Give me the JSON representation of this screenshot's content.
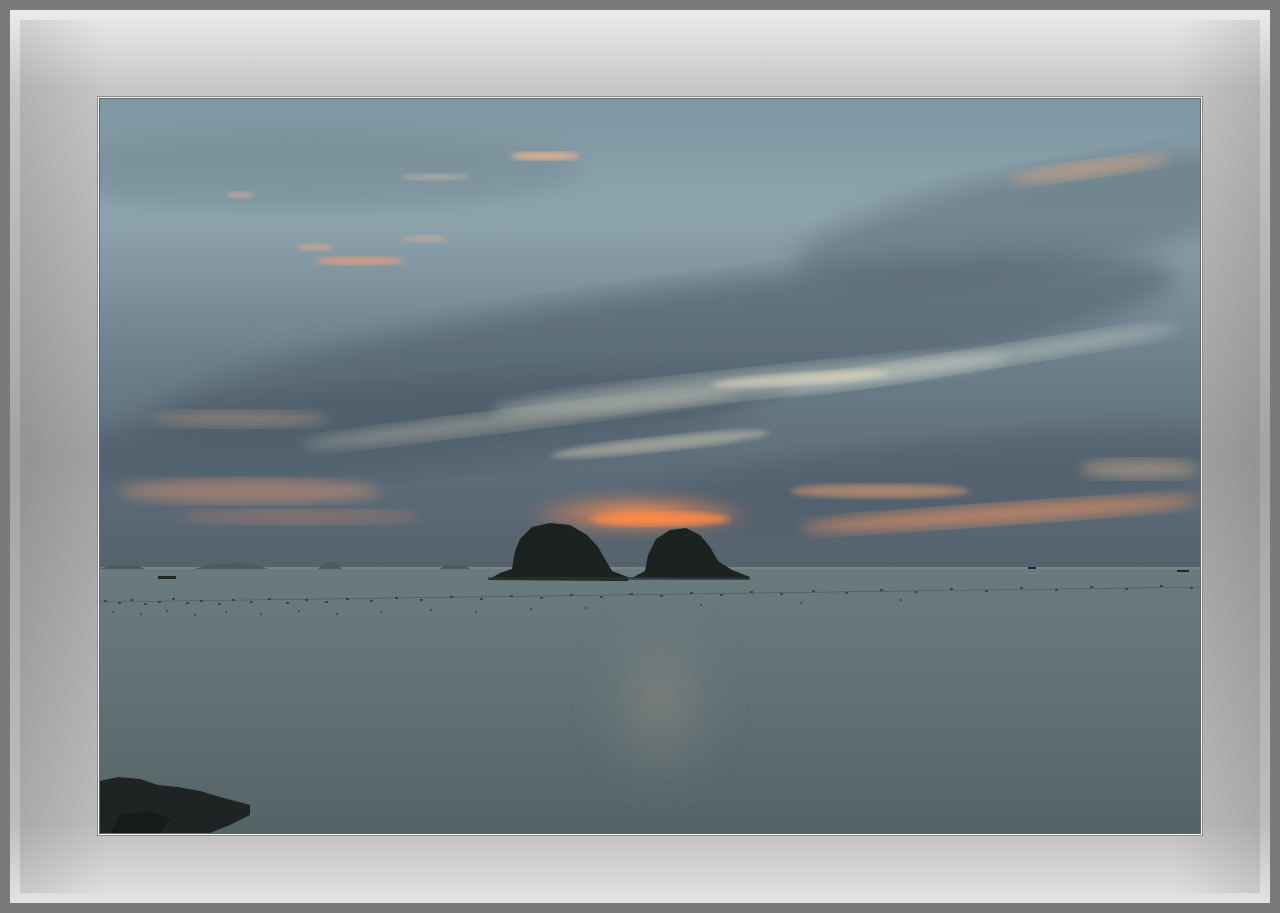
{
  "image": {
    "subject": "seascape-at-dusk",
    "colors": {
      "sky_top": "#8ea3ad",
      "sky_mid": "#6f8490",
      "cloud_dark": "#4f5f6b",
      "sunset_glow": "#f08a4b",
      "sea": "#5f6f72",
      "island": "#1c2420",
      "frame_light": "#e6e6e6",
      "frame_dark": "#7a7a7a"
    },
    "elements": [
      "sky",
      "clouds",
      "sunset-glow",
      "islands",
      "boats",
      "buoys",
      "sea",
      "foreground-rocks"
    ]
  }
}
